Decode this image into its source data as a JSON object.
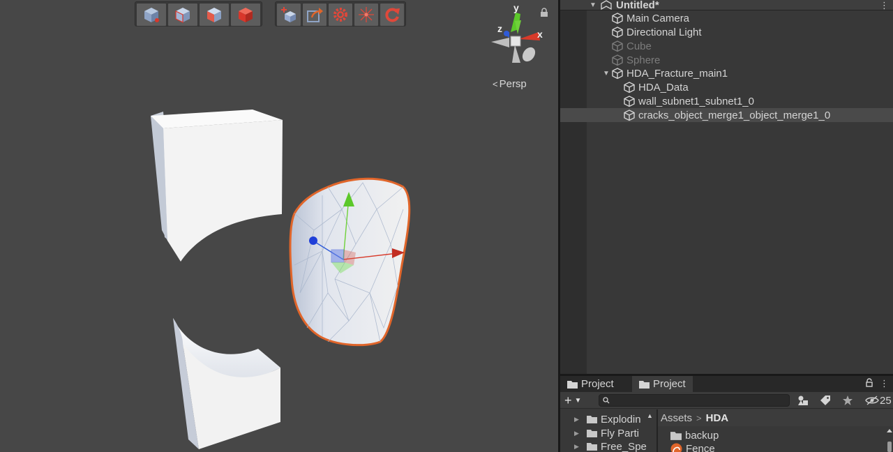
{
  "hierarchy": {
    "scene_name": "Untitled*",
    "items": [
      {
        "label": "Main Camera"
      },
      {
        "label": "Directional Light"
      },
      {
        "label": "Cube"
      },
      {
        "label": "Sphere"
      },
      {
        "label": "HDA_Fracture_main1"
      },
      {
        "label": "HDA_Data"
      },
      {
        "label": "wall_subnet1_subnet1_0"
      },
      {
        "label": "cracks_object_merge1_object_merge1_0"
      }
    ]
  },
  "scene_view": {
    "projection_label": "Persp",
    "gizmo_axes": {
      "y": "y",
      "x": "x",
      "z": "z"
    },
    "toolbar_a_icons": [
      "hda-cube-icon",
      "hda-cube-outline-icon",
      "hda-cube-shaded-icon",
      "hda-cube-red-icon"
    ],
    "toolbar_b_icons": [
      "hda-add-icon",
      "hda-export-icon",
      "hda-settings-icon",
      "hda-sparkle-icon",
      "hda-reload-icon"
    ]
  },
  "project": {
    "tabs": [
      {
        "label": "Project"
      },
      {
        "label": "Project"
      }
    ],
    "create_label": "+",
    "search_placeholder": "",
    "hidden_count": "25",
    "tree": [
      {
        "label": "Explodin"
      },
      {
        "label": "Fly Parti"
      },
      {
        "label": "Free_Spe"
      }
    ],
    "breadcrumb": {
      "root": "Assets",
      "separator": ">",
      "current": "HDA"
    },
    "assets": [
      {
        "label": "backup"
      },
      {
        "label": "Fence"
      }
    ]
  },
  "colors": {
    "selection_outline": "#e0652a",
    "accent_red": "#d9372b",
    "axis_y": "#6fd13a",
    "axis_x": "#d83a2a",
    "axis_z": "#2f5bd8"
  }
}
